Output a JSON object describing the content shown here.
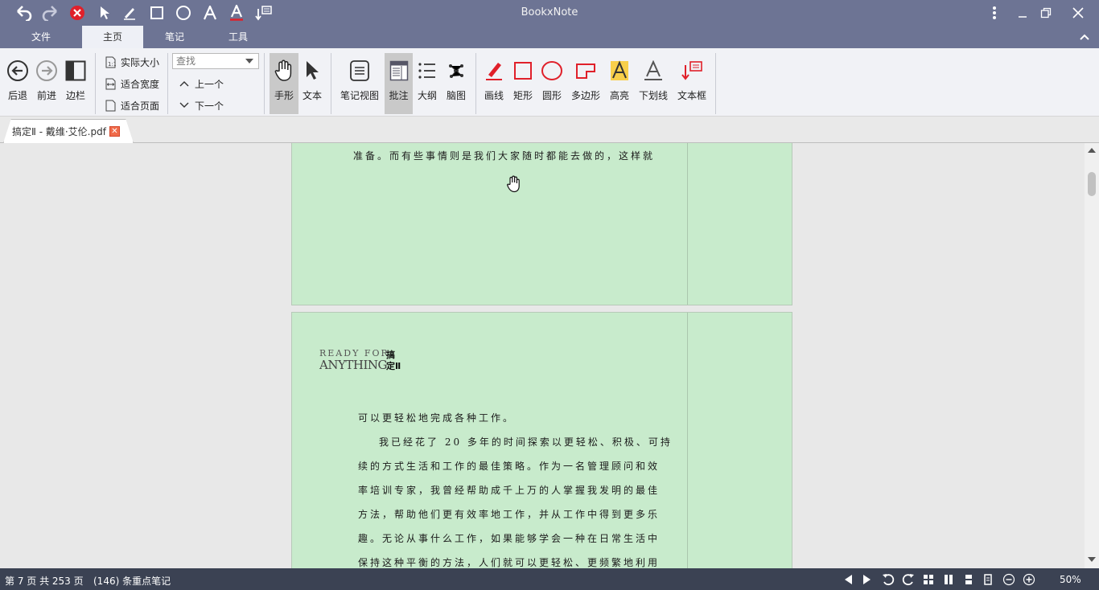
{
  "app": {
    "title": "BookxNote"
  },
  "tabs": [
    {
      "label": "文件"
    },
    {
      "label": "主页"
    },
    {
      "label": "笔记"
    },
    {
      "label": "工具"
    }
  ],
  "ribbon": {
    "nav": {
      "back": "后退",
      "forward": "前进",
      "sidebar": "边栏"
    },
    "zoom": {
      "actual_size": "实际大小",
      "fit_width": "适合宽度",
      "fit_page": "适合页面"
    },
    "search": {
      "placeholder": "查找",
      "prev": "上一个",
      "next": "下一个"
    },
    "modes": {
      "hand": "手形",
      "text": "文本"
    },
    "views": {
      "note_view": "笔记视图",
      "annotate": "批注",
      "outline": "大纲",
      "mindmap": "脑图"
    },
    "draw": {
      "line": "画线",
      "rect": "矩形",
      "circle": "圆形",
      "polygon": "多边形",
      "highlight": "高亮",
      "underline": "下划线",
      "textbox": "文本框"
    }
  },
  "document": {
    "tab_label": "搞定Ⅱ - 戴维·艾伦.pdf",
    "page1_line": "准备。而有些事情则是我们大家随时都能去做的，这样就",
    "logo": {
      "line1": "READY FOR",
      "line2": "ANYTHING",
      "cn1": "搞",
      "cn2": "定Ⅱ"
    },
    "page2_lines": [
      "可以更轻松地完成各种工作。",
      "我已经花了 20 多年的时间探索以更轻松、积极、可持",
      "续的方式生活和工作的最佳策略。作为一名管理顾问和效",
      "率培训专家，我曾经帮助成千上万的人掌握我发明的最佳",
      "方法，帮助他们更有效率地工作，并从工作中得到更多乐",
      "趣。无论从事什么工作，如果能够学会一种在日常生活中",
      "保持这种平衡的方法，人们就可以更轻松、更频繁地利用"
    ]
  },
  "status": {
    "page_info": "第 7 页 共 253 页",
    "notes_info": "(146) 条重点笔记",
    "zoom": "50%"
  },
  "colors": {
    "titlebar": "#6d7494",
    "ribbon": "#f1f2f6",
    "page": "#c8ebcc",
    "statusbar": "#3b4253",
    "accent_red": "#e0202a"
  }
}
